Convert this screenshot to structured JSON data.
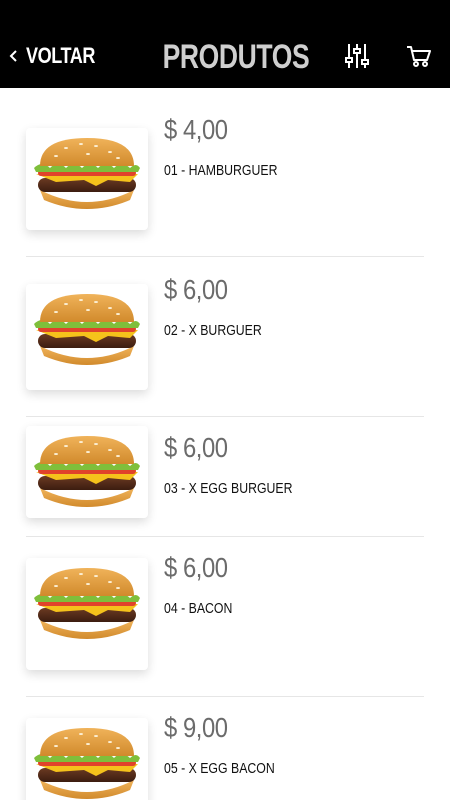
{
  "header": {
    "back_label": "VOLTAR",
    "title": "PRODUTOS",
    "filter_icon": "sliders-icon",
    "cart_icon": "cart-icon"
  },
  "colors": {
    "header_bg": "#000000",
    "title": "#cfcfcf",
    "price": "#6b6b6b",
    "name": "#111111",
    "separator": "#e6e6e6"
  },
  "products": [
    {
      "price": "$ 4,00",
      "name": "01 - HAMBURGUER",
      "image": "hamburger-image"
    },
    {
      "price": "$ 6,00",
      "name": "02 - X BURGUER",
      "image": "x-burger-image"
    },
    {
      "price": "$ 6,00",
      "name": "03 - X EGG BURGUER",
      "image": "x-egg-burger-image"
    },
    {
      "price": "$ 6,00",
      "name": "04 - BACON",
      "image": "bacon-burger-image"
    },
    {
      "price": "$ 9,00",
      "name": "05 - X EGG BACON",
      "image": "x-egg-bacon-image"
    }
  ]
}
